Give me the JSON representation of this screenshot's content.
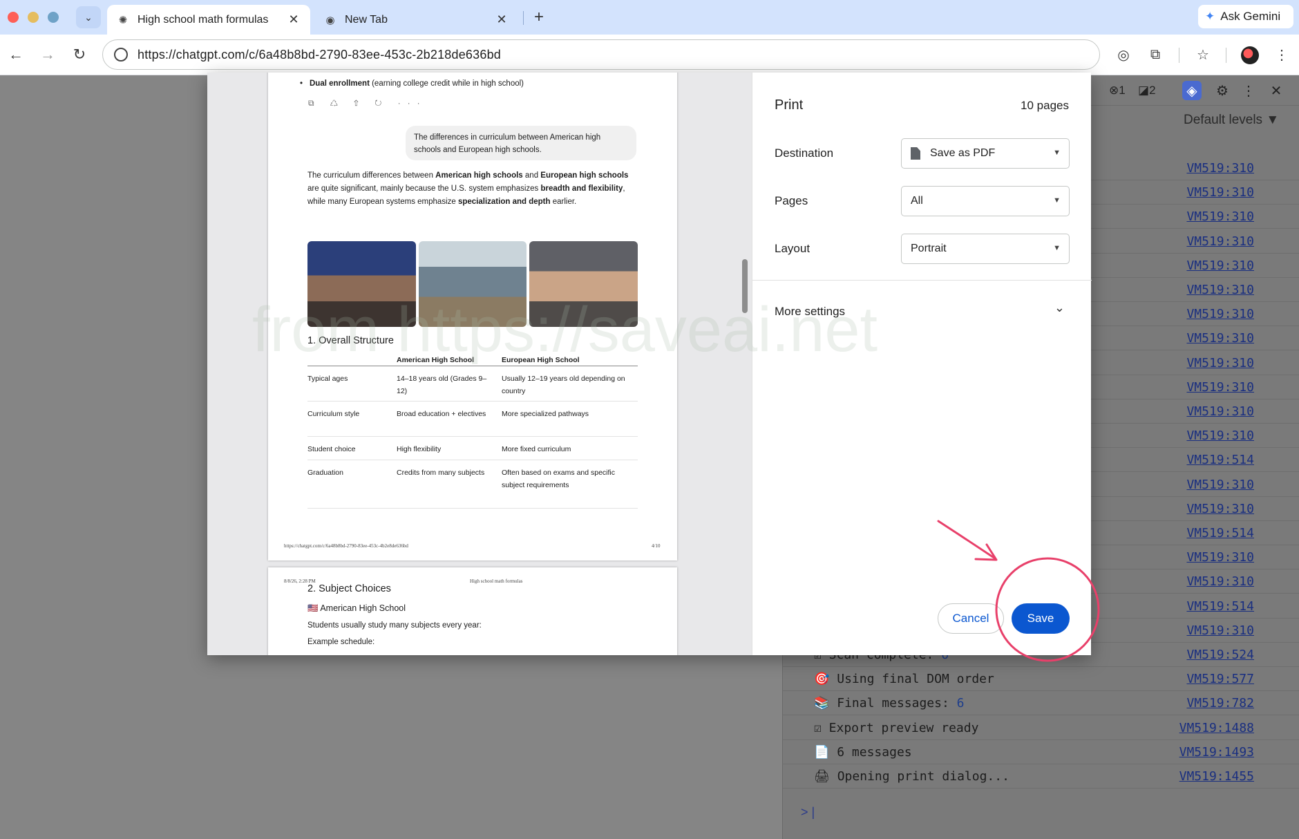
{
  "browser": {
    "tabs": [
      {
        "title": "High school math formulas",
        "active": true
      },
      {
        "title": "New Tab",
        "active": false
      }
    ],
    "gemini_label": "Ask Gemini",
    "url": "https://chatgpt.com/c/6a48b8bd-2790-83ee-453c-2b218de636bd"
  },
  "devtools": {
    "errors": "1",
    "warnings": "2",
    "levels_label": "Default levels ▼",
    "rows": [
      {
        "msg": "",
        "link": "VM519:310"
      },
      {
        "msg": "",
        "link": "VM519:310"
      },
      {
        "msg": "",
        "link": "VM519:310"
      },
      {
        "msg": "",
        "link": "VM519:310"
      },
      {
        "msg": "",
        "link": "VM519:310"
      },
      {
        "msg": "",
        "link": "VM519:310"
      },
      {
        "msg": "",
        "link": "VM519:310"
      },
      {
        "msg": "",
        "link": "VM519:310"
      },
      {
        "msg": "",
        "link": "VM519:310"
      },
      {
        "msg": "",
        "link": "VM519:310"
      },
      {
        "msg": "",
        "link": "VM519:310"
      },
      {
        "msg": "",
        "link": "VM519:310"
      },
      {
        "msg": "",
        "link": "VM519:514"
      },
      {
        "msg": "",
        "link": "VM519:310"
      },
      {
        "msg": "",
        "link": "VM519:310"
      },
      {
        "msg": "",
        "link": "VM519:514"
      },
      {
        "msg": "",
        "link": "VM519:310"
      },
      {
        "msg": "",
        "link": "VM519:310"
      },
      {
        "msg": "",
        "link": "VM519:514"
      },
      {
        "msg": "",
        "link": "VM519:310"
      },
      {
        "msg": "☑ Scan complete: ",
        "num": "6",
        "link": "VM519:524"
      },
      {
        "msg": "🎯 Using final DOM order",
        "link": "VM519:577"
      },
      {
        "msg": "📚 Final messages: ",
        "num": "6",
        "link": "VM519:782"
      },
      {
        "msg": "☑ Export preview ready",
        "link": "VM519:1488"
      },
      {
        "msg": "📄 6 messages",
        "link": "VM519:1493"
      },
      {
        "msg": "🖨 Opening print dialog...",
        "link": "VM519:1455"
      }
    ],
    "prompt": ">"
  },
  "print": {
    "title": "Print",
    "page_count": "10 pages",
    "destination_label": "Destination",
    "destination_value": "Save as PDF",
    "pages_label": "Pages",
    "pages_value": "All",
    "layout_label": "Layout",
    "layout_value": "Portrait",
    "more_settings": "More settings",
    "cancel": "Cancel",
    "save": "Save"
  },
  "preview": {
    "bullet_bold": "Dual enrollment",
    "bullet_rest": " (earning college credit while in high school)",
    "action_icons": "⧉ ♺ ⇧ ↻ ···",
    "bubble": "The differences in curriculum between American high schools and European high schools.",
    "para_1": "The curriculum differences between ",
    "para_b1": "American high schools",
    "para_2": " and ",
    "para_b2": "European high schools",
    "para_3": " are quite significant, mainly because the U.S. system emphasizes ",
    "para_b3": "breadth and flexibility",
    "para_4": ", while many European systems emphasize ",
    "para_b4": "specialization and depth",
    "para_5": " earlier.",
    "section_title": "1. Overall Structure",
    "table_head": [
      "",
      "American High School",
      "European High School"
    ],
    "table_rows": [
      [
        "Typical ages",
        "14–18 years old (Grades 9–12)",
        "Usually 12–19 years old depending on country"
      ],
      [
        "Curriculum style",
        "Broad education + electives",
        "More specialized pathways"
      ],
      [
        "Student choice",
        "High flexibility",
        "More fixed curriculum"
      ],
      [
        "Graduation",
        "Credits from many subjects",
        "Often based on exams and specific subject requirements"
      ]
    ],
    "footer_url": "https://chatgpt.com/c/6a48b8bd-2790-83ee-453c-4b2e8de636bd",
    "footer_page": "4/10",
    "page2_date": "8/8/26, 2:28 PM",
    "page2_header": "High school math formulas",
    "page2_title": "2. Subject Choices",
    "page2_subtitle": "🇺🇸 American High School",
    "page2_text": "Students usually study many subjects every year:",
    "page2_cut": "Example schedule:"
  },
  "watermark": "from https://saveai.net",
  "colors": {
    "accent": "#0b57d0",
    "annotation": "#e8406a",
    "tabbar": "#d3e3fd"
  }
}
